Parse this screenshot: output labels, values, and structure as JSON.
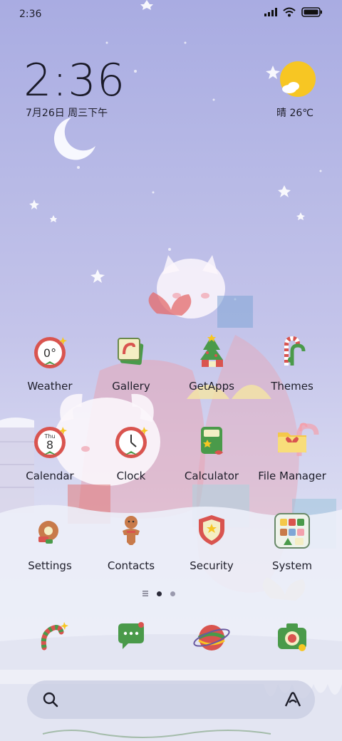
{
  "status_bar": {
    "time": "2:36"
  },
  "clock": {
    "time": "2:36",
    "date": "7月26日 周三下午"
  },
  "weather_widget": {
    "text": "晴 26℃"
  },
  "apps": [
    {
      "id": "weather",
      "label": "Weather",
      "badge": "0°"
    },
    {
      "id": "gallery",
      "label": "Gallery"
    },
    {
      "id": "getapps",
      "label": "GetApps"
    },
    {
      "id": "themes",
      "label": "Themes"
    },
    {
      "id": "calendar",
      "label": "Calendar",
      "day": "Thu",
      "date": "8"
    },
    {
      "id": "clock",
      "label": "Clock"
    },
    {
      "id": "calculator",
      "label": "Calculator"
    },
    {
      "id": "filemanager",
      "label": "File Manager"
    },
    {
      "id": "settings",
      "label": "Settings"
    },
    {
      "id": "contacts",
      "label": "Contacts"
    },
    {
      "id": "security",
      "label": "Security"
    },
    {
      "id": "system",
      "label": "System"
    }
  ],
  "page_indicator": {
    "pages": 2,
    "current": 1
  },
  "dock": [
    "phone-cane",
    "messages",
    "browser-ornament",
    "camera"
  ],
  "colors": {
    "accent_red": "#d9544f",
    "accent_green": "#4a9a4a",
    "sun": "#f7c623"
  }
}
